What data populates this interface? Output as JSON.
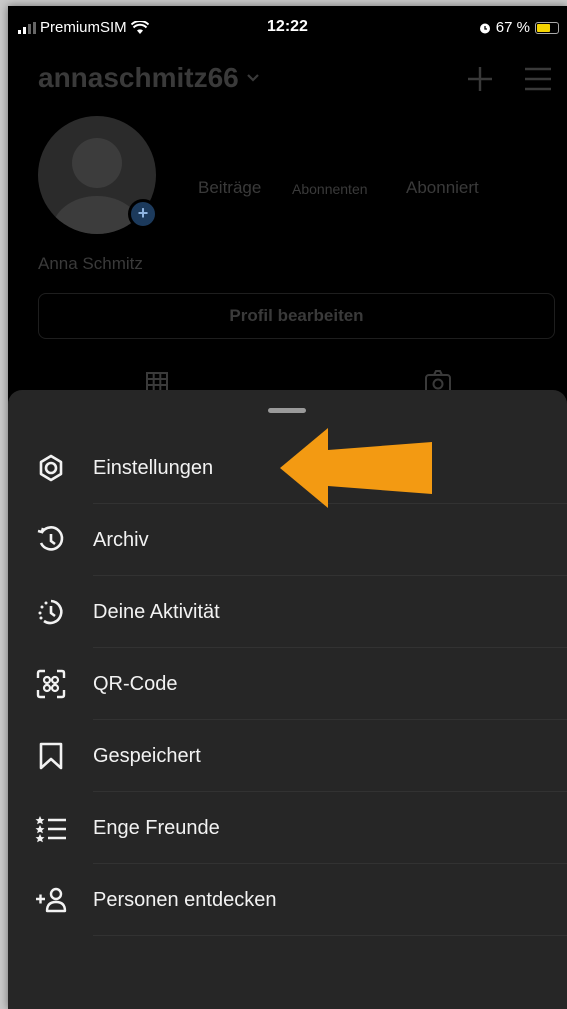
{
  "status_bar": {
    "carrier": "PremiumSIM",
    "time": "12:22",
    "battery": "67 %",
    "battery_level": 0.67
  },
  "header": {
    "username": "annaschmitz66",
    "dropdown_icon": "chevron-down-icon",
    "add_icon": "plus-icon",
    "menu_icon": "hamburger-icon"
  },
  "profile": {
    "stats_labels": [
      "Beiträge",
      "Abonnenten",
      "Abonniert"
    ],
    "full_name": "Anna Schmitz",
    "edit_button": "Profil bearbeiten"
  },
  "sheet": {
    "items": [
      {
        "label": "Einstellungen",
        "icon": "settings-icon"
      },
      {
        "label": "Archiv",
        "icon": "archive-icon"
      },
      {
        "label": "Deine Aktivität",
        "icon": "activity-icon"
      },
      {
        "label": "QR-Code",
        "icon": "qr-code-icon"
      },
      {
        "label": "Gespeichert",
        "icon": "bookmark-icon"
      },
      {
        "label": "Enge Freunde",
        "icon": "close-friends-icon"
      },
      {
        "label": "Personen entdecken",
        "icon": "add-person-icon"
      }
    ]
  },
  "colors": {
    "background": "#000000",
    "sheet": "#262626",
    "arrow": "#f39a12",
    "text": "#f2f2f2",
    "dim_text": "#3a3a3a"
  }
}
